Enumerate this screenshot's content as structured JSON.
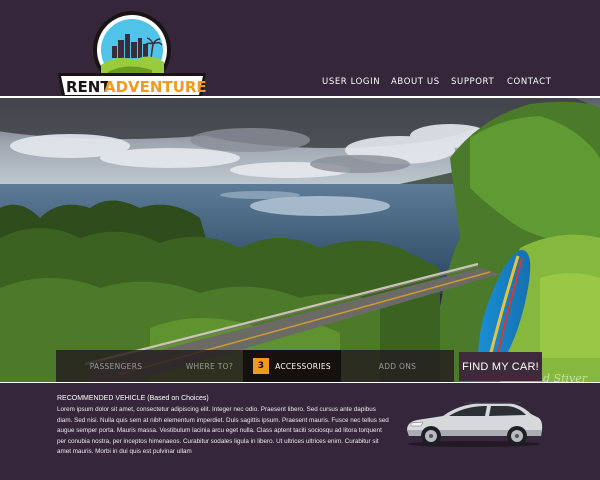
{
  "brand": {
    "logo_text_part1": "RENT",
    "logo_text_part2": "ADVENTURE"
  },
  "nav": {
    "items": [
      "USER LOGIN",
      "ABOUT US",
      "SUPPORT",
      "CONTACT"
    ]
  },
  "steps": {
    "items": [
      {
        "label": "PASSENGERS"
      },
      {
        "label": "WHERE TO?"
      },
      {
        "label": "ACCESSORIES",
        "number": "3"
      },
      {
        "label": "ADD ONS"
      }
    ],
    "active_index": 2
  },
  "find_button": {
    "label": "FIND MY CAR!"
  },
  "watermark": "d Stiver",
  "recommended": {
    "title": "RECOMMENDED VEHICLE (Based on Choices)",
    "body": "Lorem ipsum dolor sit amet, consectetur adipiscing elit. Integer nec odio. Praesent libero. Sed cursus ante dapibus diam. Sed nisi. Nulla quis sem at nibh elementum imperdiet. Duis sagittis ipsum. Praesent mauris. Fusce nec tellus sed augue semper porta. Mauris massa. Vestibulum lacinia arcu eget nulla. Class aptent taciti sociosqu ad litora torquent per conubia nostra, per inceptos himenaeos. Curabitur sodales ligula in libero. Ut ultrices ultrices enim. Curabitur sit amet mauris. Morbi in dui quis est pulvinar ullam"
  },
  "colors": {
    "background": "#35263a",
    "accent_orange": "#f2991e",
    "logo_green": "#9acb3c",
    "step_active": "#15110f"
  }
}
